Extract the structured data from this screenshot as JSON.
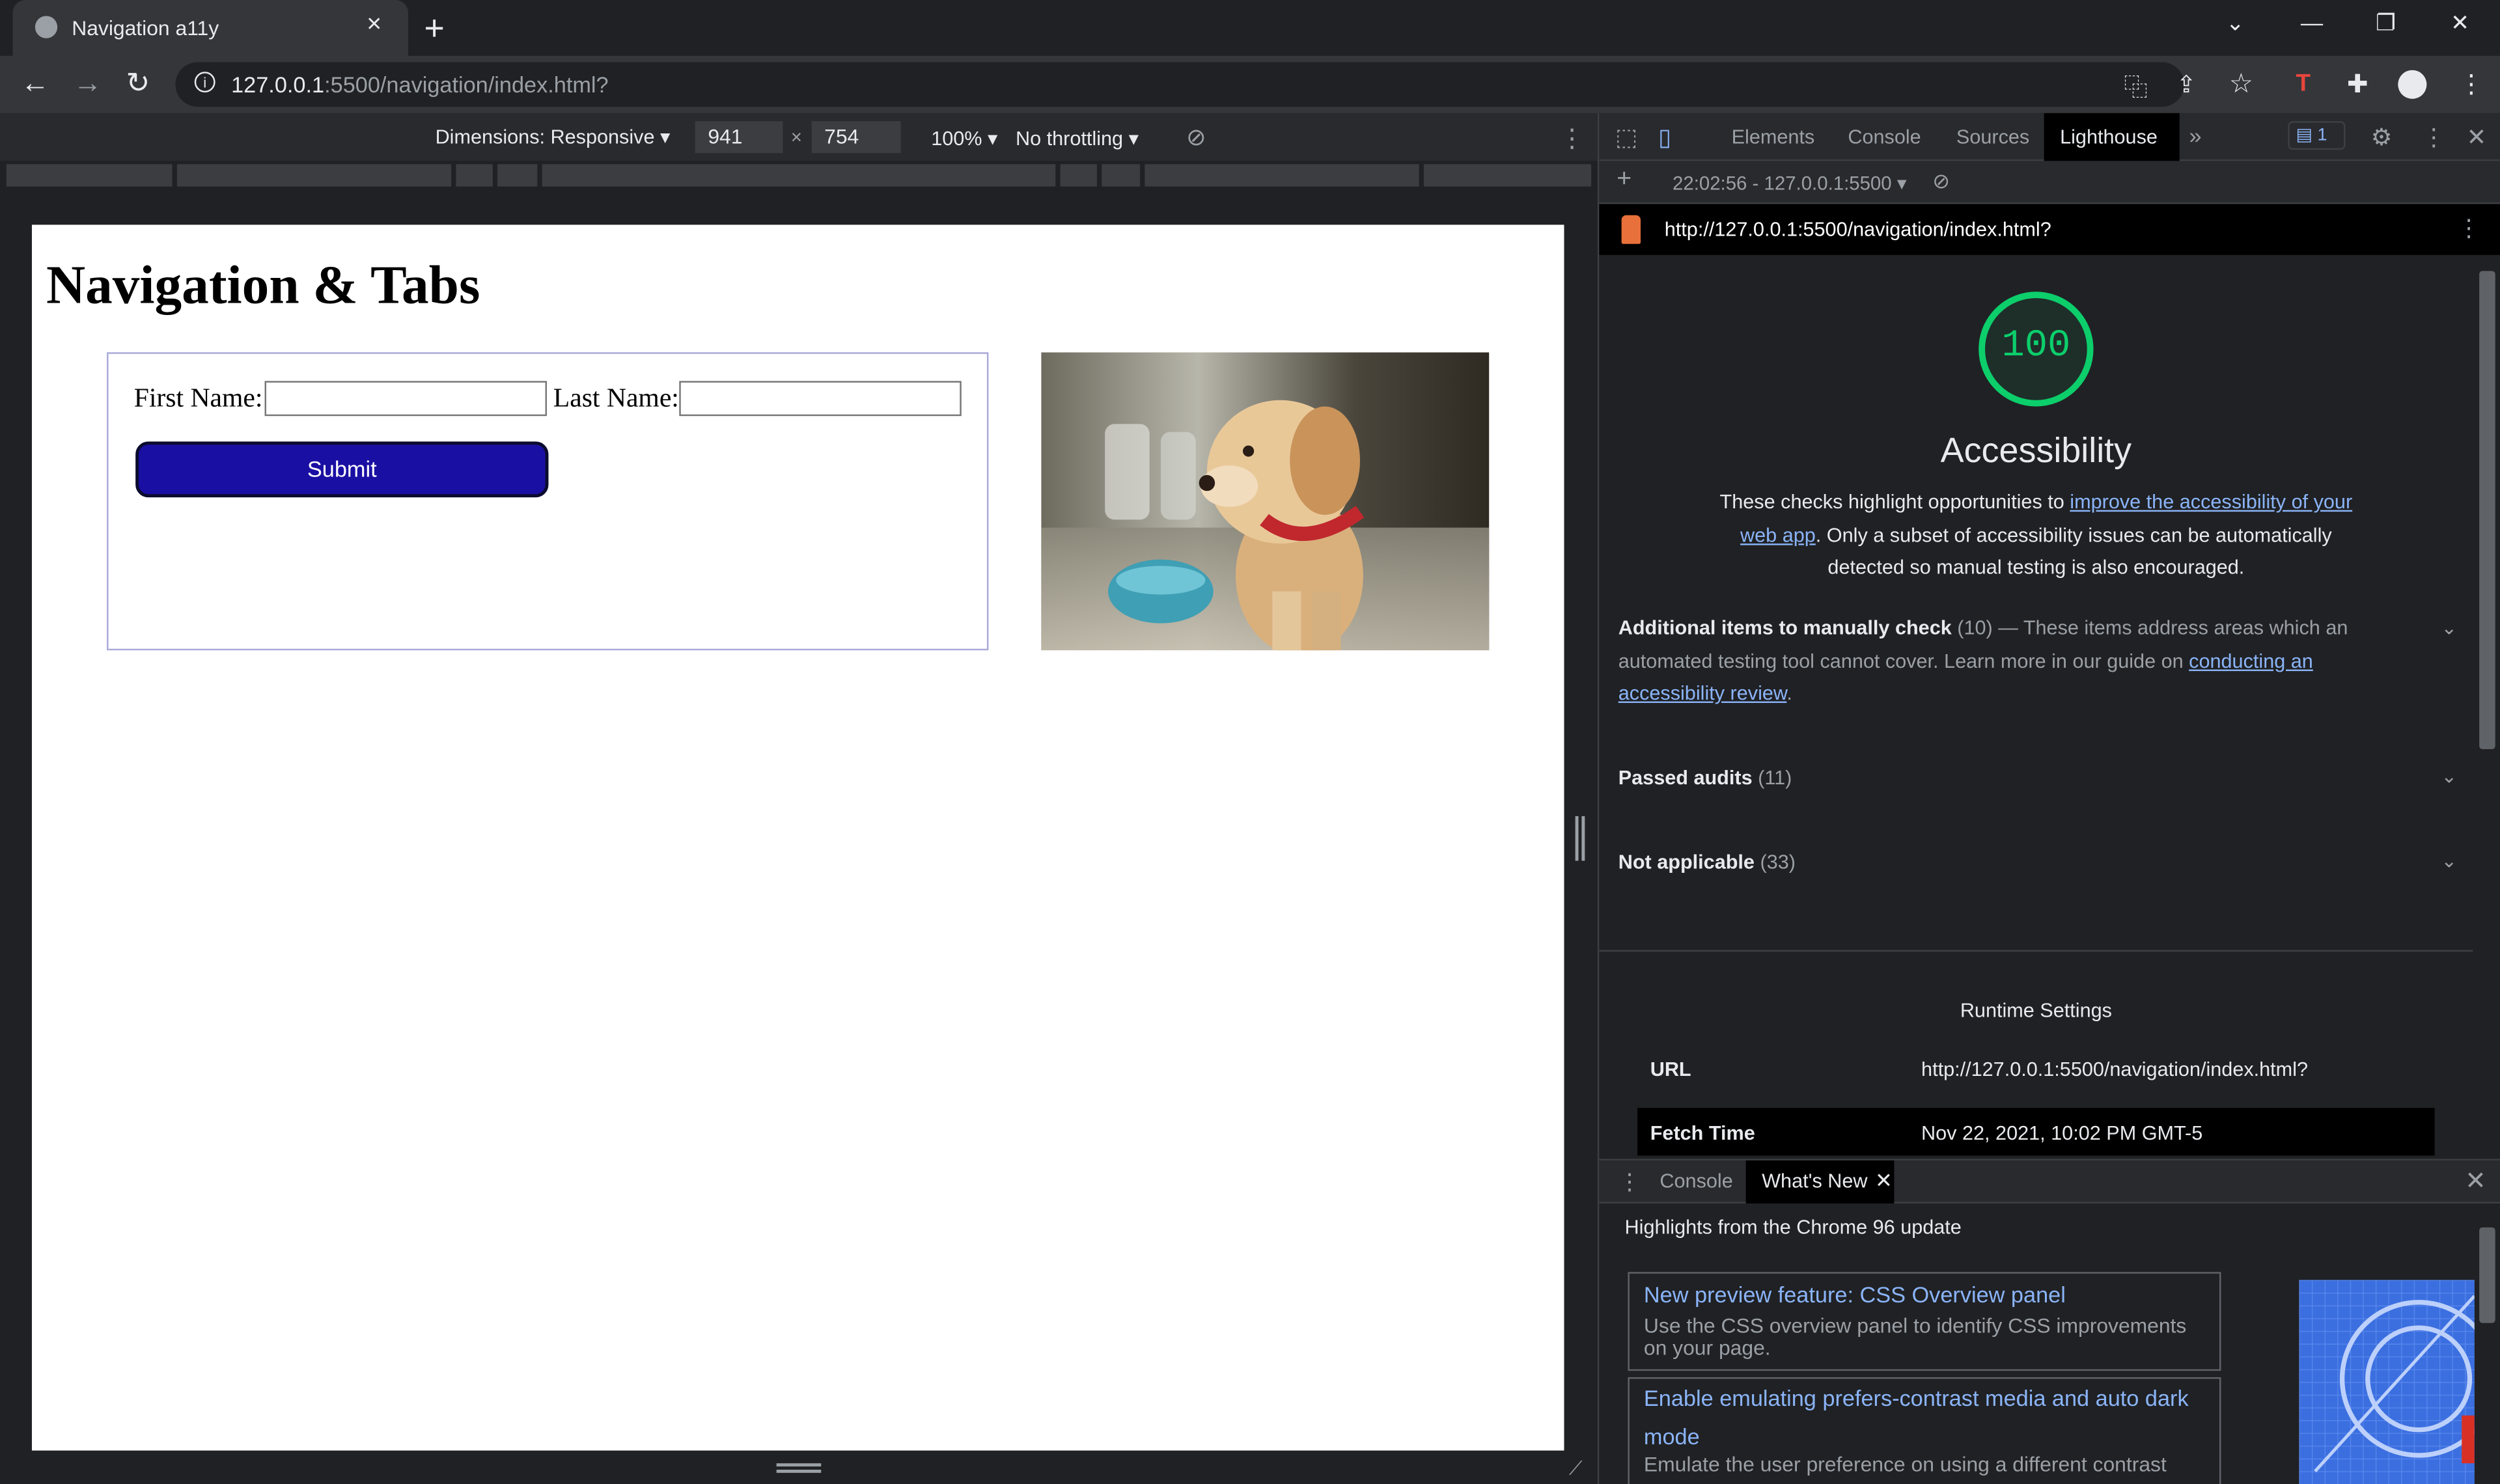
{
  "browser": {
    "tab_title": "Navigation a11y",
    "tab_close": "×",
    "new_tab": "+",
    "url_host": "127.0.0.1",
    "url_path": ":5500/navigation/index.html?",
    "window_controls": [
      "⌄",
      "—",
      "❐",
      "✕"
    ]
  },
  "device_toolbar": {
    "dimensions": "Dimensions: Responsive",
    "width": "941",
    "height": "754",
    "times": "×",
    "zoom": "100%",
    "throttling": "No throttling"
  },
  "page": {
    "heading": "Navigation & Tabs",
    "first_name_label": "First Name:",
    "last_name_label": "Last Name:",
    "submit_label": "Submit"
  },
  "devtools": {
    "tabs": [
      "Elements",
      "Console",
      "Sources",
      "Lighthouse"
    ],
    "issues_count": "1",
    "report_selector": "22:02:56 - 127.0.0.1:5500",
    "report_url": "http://127.0.0.1:5500/navigation/index.html?",
    "score": "100",
    "score_fraction": 1.0,
    "score_color": "#0cce6b",
    "category_title": "Accessibility",
    "desc_pre": "These checks highlight opportunities to ",
    "desc_link": "improve the accessibility of your web app",
    "desc_post": ". Only a subset of accessibility issues can be automatically detected so manual testing is also encouraged.",
    "manual_title": "Additional items to manually check",
    "manual_count": "(10)",
    "manual_desc": " — These items address areas which an automated testing tool cannot cover. Learn more in our guide on ",
    "manual_link": "conducting an accessibility review",
    "manual_end": ".",
    "passed_title": "Passed audits",
    "passed_count": "(11)",
    "na_title": "Not applicable",
    "na_count": "(33)",
    "runtime_title": "Runtime Settings",
    "runtime_rows": [
      {
        "key": "URL",
        "value": "http://127.0.0.1:5500/navigation/index.html?"
      },
      {
        "key": "Fetch Time",
        "value": "Nov 22, 2021, 10:02 PM GMT-5"
      }
    ]
  },
  "drawer": {
    "console_tab": "Console",
    "whats_new_tab": "What's New",
    "heading": "Highlights from the Chrome 96 update",
    "cards": [
      {
        "title": "New preview feature: CSS Overview panel",
        "desc": "Use the CSS overview panel to identify CSS improvements on your page."
      },
      {
        "title": "Enable emulating prefers-contrast media and auto dark mode",
        "desc": "Emulate the user preference on using a different contrast"
      }
    ]
  }
}
